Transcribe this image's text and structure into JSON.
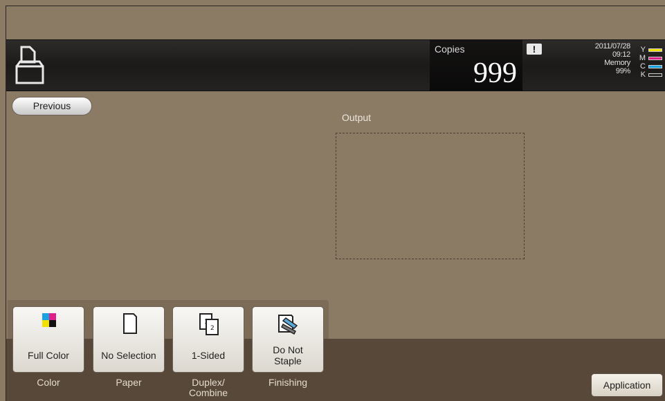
{
  "header": {
    "job_icon": "output-tray-icon",
    "copies_label": "Copies",
    "copies_value": "999",
    "alert_icon": "!",
    "date": "2011/07/28",
    "time": "09:12",
    "memory_label": "Memory",
    "memory_value": "99%",
    "toner": [
      {
        "letter": "Y",
        "color": "#f2e100"
      },
      {
        "letter": "M",
        "color": "#e0208a"
      },
      {
        "letter": "C",
        "color": "#1aa2e0"
      },
      {
        "letter": "K",
        "color": "#222222"
      }
    ]
  },
  "main": {
    "previous_label": "Previous",
    "output_label": "Output"
  },
  "functions": [
    {
      "label": "Full Color",
      "caption": "Color",
      "icon": "full-color-icon"
    },
    {
      "label": "No Selection",
      "caption": "Paper",
      "icon": "paper-icon"
    },
    {
      "label": "1-Sided",
      "caption": "Duplex/\nCombine",
      "icon": "duplex-icon"
    },
    {
      "label": "Do Not\nStaple",
      "caption": "Finishing",
      "icon": "staple-icon"
    }
  ],
  "application_label": "Application"
}
